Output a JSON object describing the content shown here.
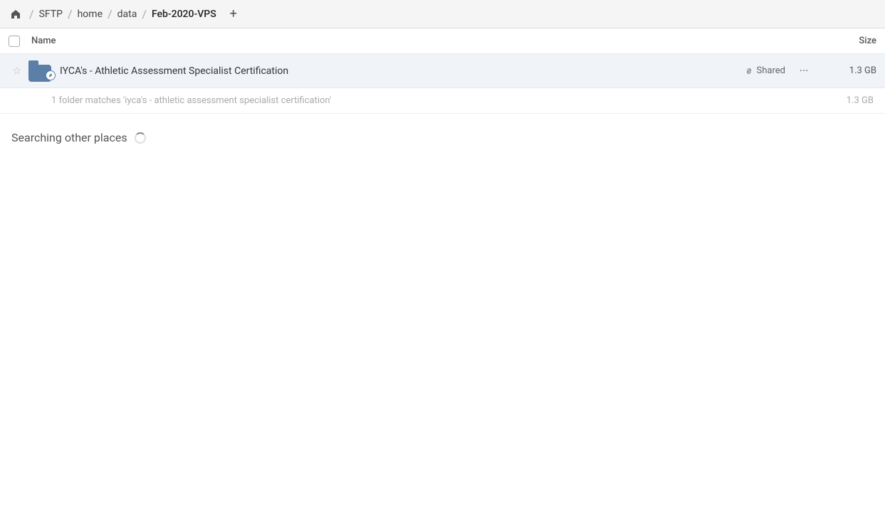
{
  "header": {
    "home_icon": "🏠",
    "breadcrumbs": [
      {
        "label": "SFTP",
        "active": false
      },
      {
        "label": "home",
        "active": false
      },
      {
        "label": "data",
        "active": false
      },
      {
        "label": "Feb-2020-VPS",
        "active": true
      }
    ],
    "add_tab_icon": "+"
  },
  "columns": {
    "name_label": "Name",
    "size_label": "Size"
  },
  "file_row": {
    "folder_name": "IYCA's - Athletic Assessment Specialist Certification",
    "shared_label": "Shared",
    "size": "1.3 GB",
    "more_icon": "···",
    "star_icon": "☆",
    "link_icon": "🔗"
  },
  "match_info": {
    "text": "1 folder matches 'iyca's - athletic assessment specialist certification'",
    "size": "1.3 GB"
  },
  "searching": {
    "title": "Searching other places"
  }
}
